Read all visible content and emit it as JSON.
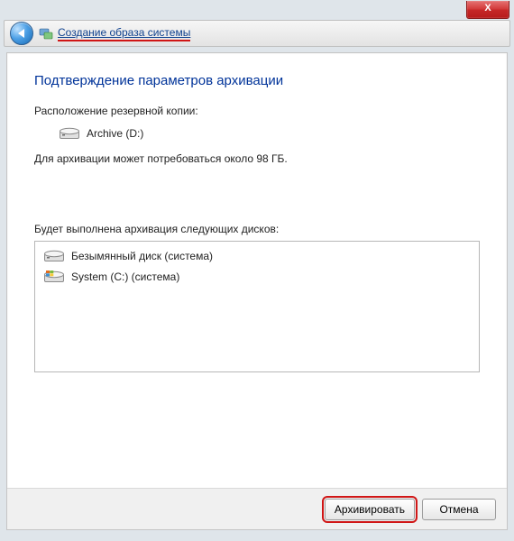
{
  "window": {
    "close_label": "X"
  },
  "header": {
    "breadcrumb": "Создание образа системы"
  },
  "page": {
    "title": "Подтверждение параметров архивации",
    "backup_location_label": "Расположение резервной копии:",
    "backup_drive": "Archive (D:)",
    "size_line": "Для архивации может потребоваться около 98 ГБ.",
    "disk_list_label": "Будет выполнена архивация следующих дисков:",
    "disks": [
      {
        "name": "Безымянный диск (система)"
      },
      {
        "name": "System (C:) (система)"
      }
    ]
  },
  "buttons": {
    "archive": "Архивировать",
    "cancel": "Отмена"
  }
}
